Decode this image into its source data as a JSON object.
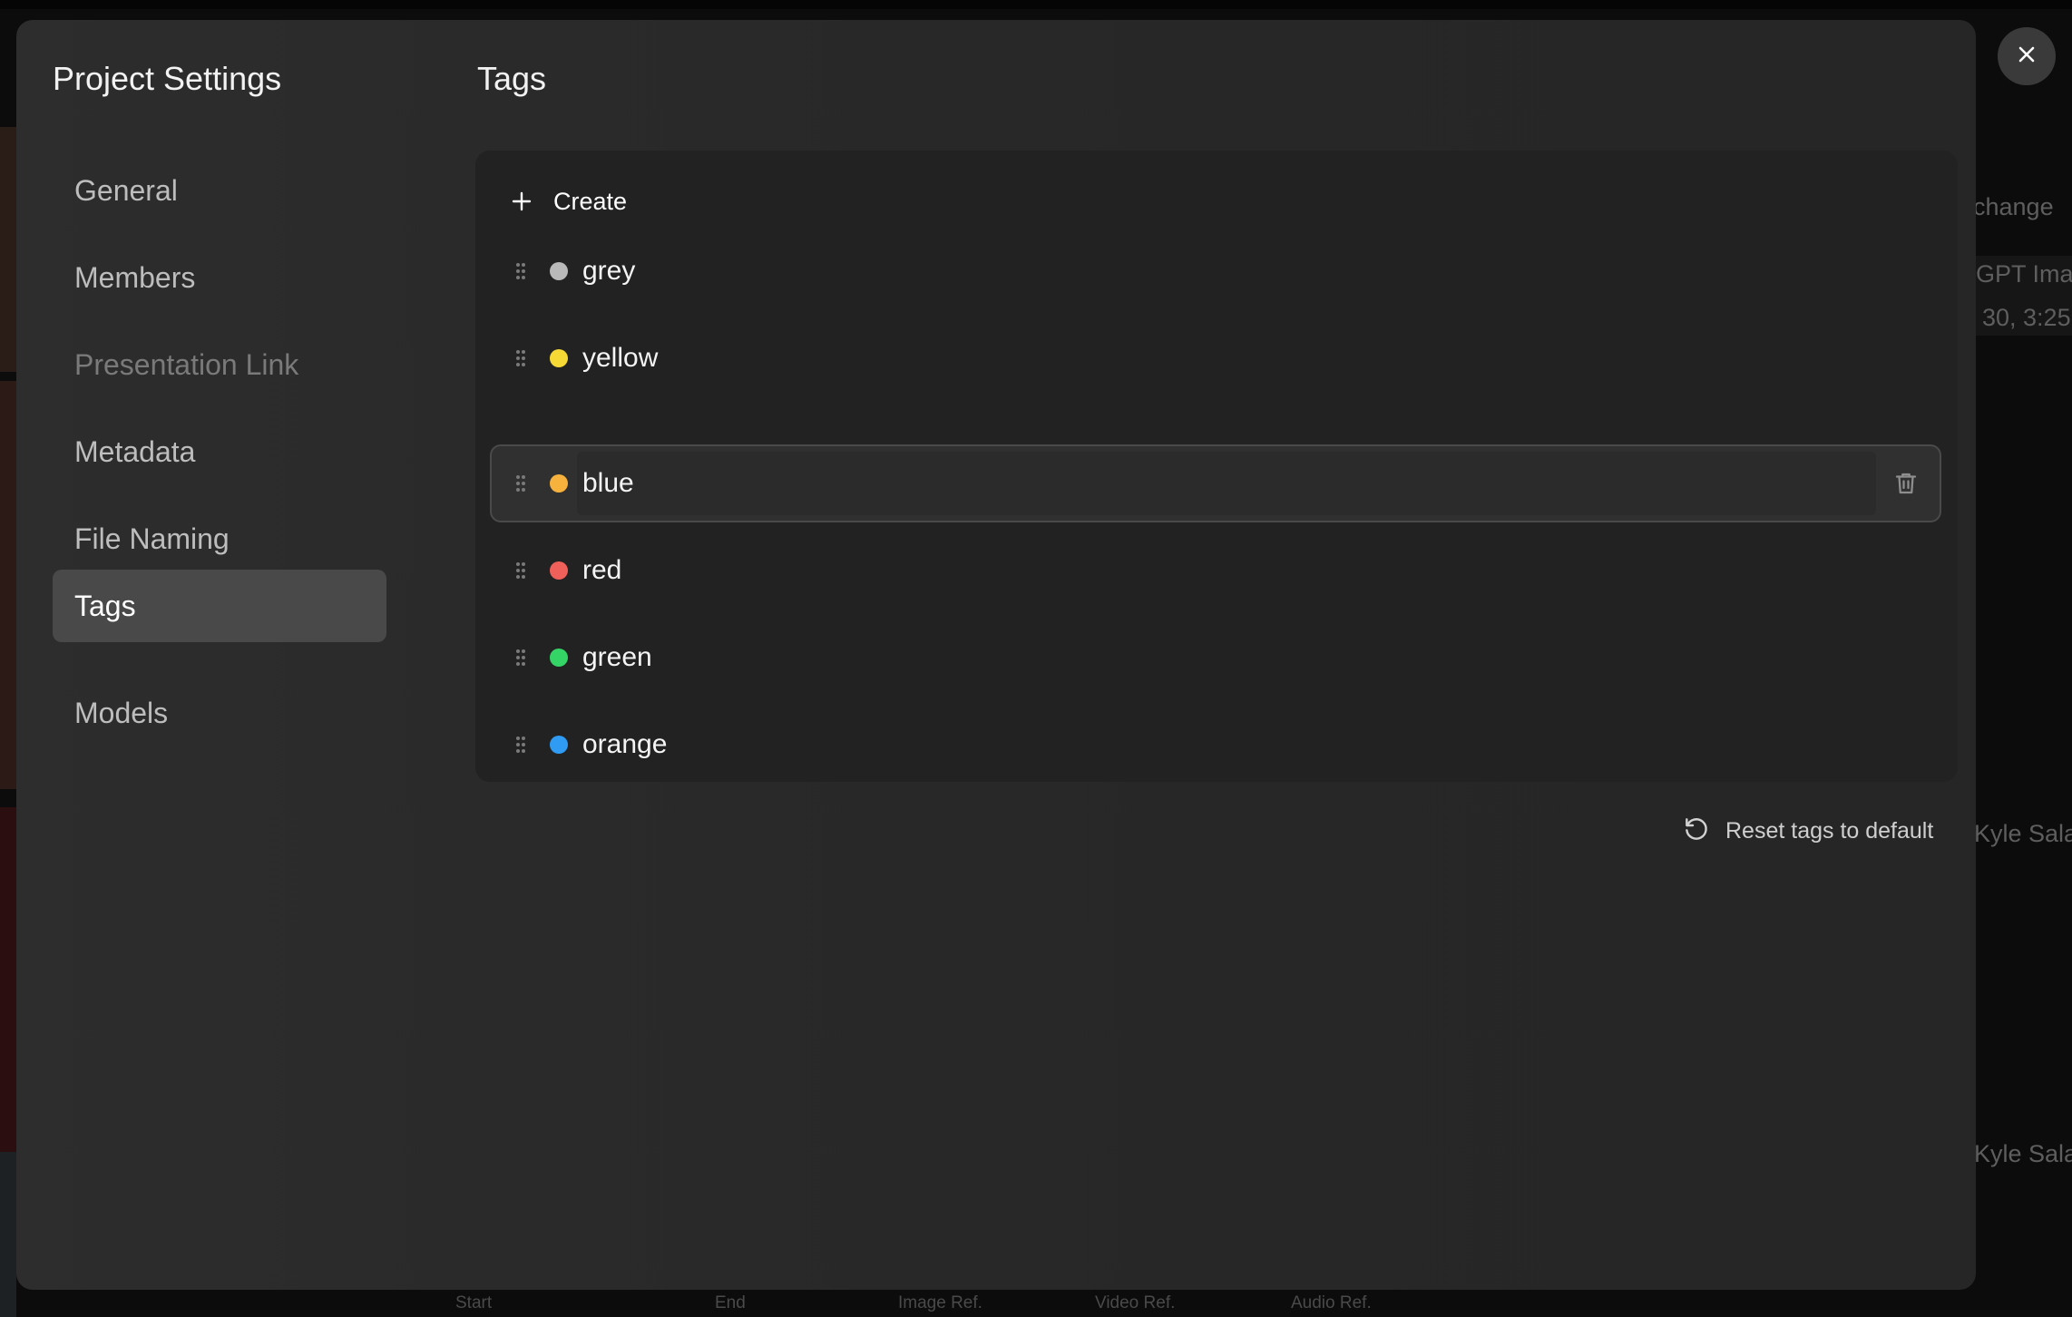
{
  "background": {
    "texts": [
      "t change",
      "GPT Imag",
      ". 30, 3:25",
      "Kyle Sala",
      "Kyle Sala"
    ],
    "bottom_labels": [
      "Start",
      "End",
      "Image Ref.",
      "Video Ref.",
      "Audio Ref."
    ]
  },
  "sidebar": {
    "title": "Project Settings",
    "items": [
      {
        "label": "General",
        "state": "normal"
      },
      {
        "label": "Members",
        "state": "normal"
      },
      {
        "label": "Presentation Link",
        "state": "disabled"
      },
      {
        "label": "Metadata",
        "state": "normal"
      },
      {
        "label": "File Naming",
        "state": "normal"
      },
      {
        "label": "Tags",
        "state": "active"
      },
      {
        "label": "Models",
        "state": "normal"
      }
    ]
  },
  "content": {
    "title": "Tags",
    "create_label": "Create",
    "tags": [
      {
        "label": "grey",
        "color": "#b9b9b9"
      },
      {
        "label": "yellow",
        "color": "#f6d935"
      },
      {
        "label": "blue",
        "color": "#f6b23c"
      },
      {
        "label": "red",
        "color": "#f0605a"
      },
      {
        "label": "green",
        "color": "#35d467"
      },
      {
        "label": "orange",
        "color": "#2f9bf3"
      }
    ],
    "reset_label": "Reset tags to default"
  },
  "colors": {
    "accent_arrow": "#e8323f",
    "active_nav": "#494949"
  },
  "icons": {
    "create": "plus-icon",
    "drag": "drag-handle-icon",
    "delete": "trash-icon",
    "reset": "reset-icon",
    "close": "close-icon",
    "annotation": "arrow-annotation"
  }
}
